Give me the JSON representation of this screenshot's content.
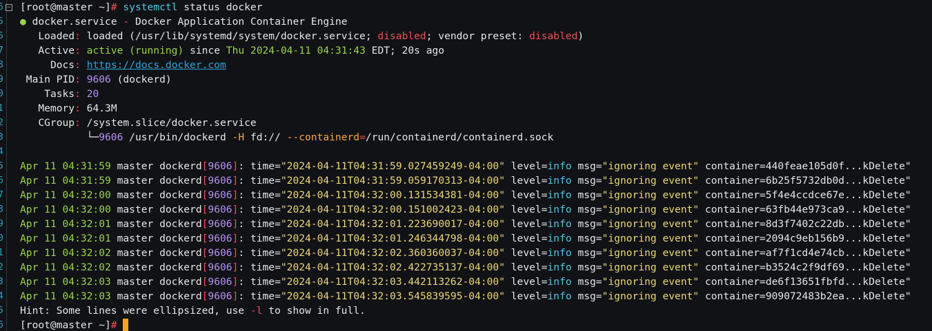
{
  "gutter": [
    "6",
    "5",
    "6",
    "7",
    "8",
    "9",
    "0",
    "1",
    "2",
    "3",
    "4",
    "5",
    "6",
    "7",
    "8",
    "9",
    "0",
    "1",
    "2",
    "3",
    "4",
    "5",
    "6",
    "7"
  ],
  "fold_icon": "minus-box-icon",
  "command": {
    "prompt": "[root@master ~]",
    "hash": "#",
    "cmd": "systemctl",
    "args": " status docker"
  },
  "status": {
    "bullet": "●",
    "unit": "docker.service",
    "dash": "-",
    "description": "Docker Application Container Engine",
    "loaded_label": "Loaded",
    "loaded_value": "loaded (/usr/lib/systemd/system/docker.service;",
    "loaded_disabled": "disabled",
    "loaded_vendor": "; vendor preset: ",
    "loaded_vendor_value": "disabled",
    "loaded_close": ")",
    "active_label": "Active",
    "active_value": "active (running)",
    "active_since": "since ",
    "active_date": "Thu 2024-04-11 04:31:43",
    "active_tz": " EDT; 20s ago",
    "docs_label": "Docs",
    "docs_value": "https://docs.docker.com",
    "pid_label": "Main PID",
    "pid_value": "9606",
    "pid_name": " (dockerd)",
    "tasks_label": "Tasks",
    "tasks_value": "20",
    "memory_label": "Memory",
    "memory_value": "64.3M",
    "cgroup_label": "CGroup",
    "cgroup_value": "/system.slice/docker.service",
    "tree_prefix": "└─",
    "tree_pid": "9606",
    "tree_cmd": " /usr/bin/dockerd ",
    "tree_flag_h": "-H",
    "tree_fd": " fd:// ",
    "tree_flag_c": "--containerd",
    "tree_eq": "=",
    "tree_sock": "/run/containerd/containerd.sock"
  },
  "logs": [
    {
      "date": "Apr 11 04:31:59",
      "host": "master",
      "proc": "dockerd",
      "pid": "9606",
      "time": "2024-04-11T04:31:59.027459249-04:00",
      "level": "info",
      "msg": "ignoring event",
      "container": "440feae105d0f...kDelete\""
    },
    {
      "date": "Apr 11 04:31:59",
      "host": "master",
      "proc": "dockerd",
      "pid": "9606",
      "time": "2024-04-11T04:31:59.059170313-04:00",
      "level": "info",
      "msg": "ignoring event",
      "container": "6b25f5732db0d...kDelete\""
    },
    {
      "date": "Apr 11 04:32:00",
      "host": "master",
      "proc": "dockerd",
      "pid": "9606",
      "time": "2024-04-11T04:32:00.131534381-04:00",
      "level": "info",
      "msg": "ignoring event",
      "container": "5f4e4ccdce67e...kDelete\""
    },
    {
      "date": "Apr 11 04:32:00",
      "host": "master",
      "proc": "dockerd",
      "pid": "9606",
      "time": "2024-04-11T04:32:00.151002423-04:00",
      "level": "info",
      "msg": "ignoring event",
      "container": "63fb44e973ca9...kDelete\""
    },
    {
      "date": "Apr 11 04:32:01",
      "host": "master",
      "proc": "dockerd",
      "pid": "9606",
      "time": "2024-04-11T04:32:01.223690017-04:00",
      "level": "info",
      "msg": "ignoring event",
      "container": "8d3f7402c22db...kDelete\""
    },
    {
      "date": "Apr 11 04:32:01",
      "host": "master",
      "proc": "dockerd",
      "pid": "9606",
      "time": "2024-04-11T04:32:01.246344798-04:00",
      "level": "info",
      "msg": "ignoring event",
      "container": "2094c9eb156b9...kDelete\""
    },
    {
      "date": "Apr 11 04:32:02",
      "host": "master",
      "proc": "dockerd",
      "pid": "9606",
      "time": "2024-04-11T04:32:02.360360037-04:00",
      "level": "info",
      "msg": "ignoring event",
      "container": "af7f1cd4e74cb...kDelete\""
    },
    {
      "date": "Apr 11 04:32:02",
      "host": "master",
      "proc": "dockerd",
      "pid": "9606",
      "time": "2024-04-11T04:32:02.422735137-04:00",
      "level": "info",
      "msg": "ignoring event",
      "container": "b3524c2f9df69...kDelete\""
    },
    {
      "date": "Apr 11 04:32:03",
      "host": "master",
      "proc": "dockerd",
      "pid": "9606",
      "time": "2024-04-11T04:32:03.442113262-04:00",
      "level": "info",
      "msg": "ignoring event",
      "container": "de6f13651fbfd...kDelete\""
    },
    {
      "date": "Apr 11 04:32:03",
      "host": "master",
      "proc": "dockerd",
      "pid": "9606",
      "time": "2024-04-11T04:32:03.545839595-04:00",
      "level": "info",
      "msg": "ignoring event",
      "container": "909072483b2ea...kDelete\""
    }
  ],
  "hint": {
    "prefix": "Hint: Some lines were ellipsized, use ",
    "flag": "-l",
    "suffix": " to show in full."
  },
  "final_prompt": {
    "prompt": "[root@master ~]",
    "hash": "#"
  },
  "colors": {
    "background": "#111216",
    "cursor": "#f2a618",
    "green": "#99d34a",
    "red": "#ee4f55",
    "purple": "#b592f2",
    "yellow": "#ead67a",
    "cyan": "#53c4e5"
  }
}
